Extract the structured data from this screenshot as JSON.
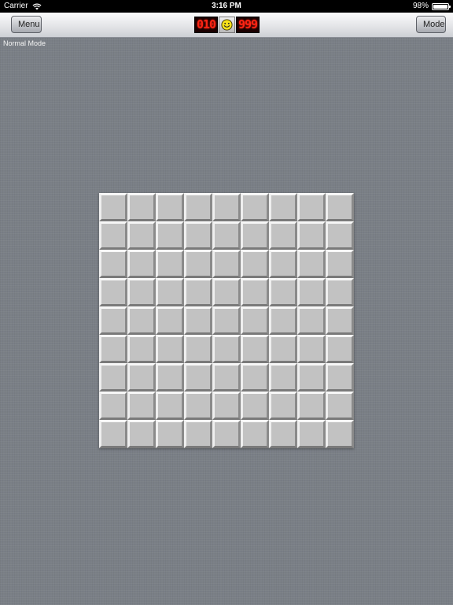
{
  "status_bar": {
    "carrier": "Carrier",
    "time": "3:16 PM",
    "battery_text": "98%",
    "battery_level": 0.98
  },
  "toolbar": {
    "menu_label": "Menu",
    "mode_label": "Mode",
    "mine_counter": "010",
    "timer": "999",
    "face_icon": "smiley-icon"
  },
  "game": {
    "mode_text": "Normal Mode",
    "rows": 9,
    "cols": 9,
    "cell_state": "unrevealed"
  },
  "colors": {
    "led_red": "#ff2414",
    "smiley_yellow": "#f7e21a",
    "cell_gray": "#c2c2c2"
  }
}
